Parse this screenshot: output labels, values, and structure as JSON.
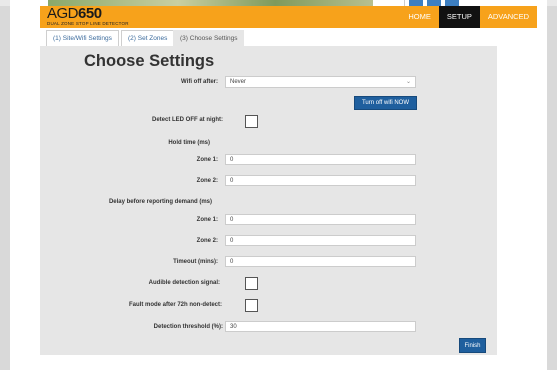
{
  "header": {
    "logo_light": "AGD",
    "logo_bold": "650",
    "logo_sub": "DUAL ZONE STOP LINE DETECTOR",
    "nav": [
      {
        "label": "HOME",
        "active": false
      },
      {
        "label": "SETUP",
        "active": true
      },
      {
        "label": "ADVANCED",
        "active": false
      }
    ]
  },
  "tabs": [
    {
      "label": "(1) Site/Wifi Settings"
    },
    {
      "label": "(2) Set Zones"
    },
    {
      "label": "(3) Choose Settings",
      "active": true
    }
  ],
  "form": {
    "title": "Choose Settings",
    "wifi_off_label": "Wifi off after:",
    "wifi_off_value": "Never",
    "turn_off_wifi_button": "Turn off wifi NOW",
    "detect_led_label": "Detect LED OFF at night:",
    "hold_time_label": "Hold time (ms)",
    "hold_zone1_label": "Zone 1:",
    "hold_zone1_value": "0",
    "hold_zone2_label": "Zone 2:",
    "hold_zone2_value": "0",
    "delay_label": "Delay before reporting demand (ms)",
    "delay_zone1_label": "Zone 1:",
    "delay_zone1_value": "0",
    "delay_zone2_label": "Zone 2:",
    "delay_zone2_value": "0",
    "timeout_label": "Timeout (mins):",
    "timeout_value": "0",
    "audible_label": "Audible detection signal:",
    "fault_mode_label": "Fault mode after 72h non-detect:",
    "threshold_label": "Detection threshold (%):",
    "threshold_value": "30",
    "finish_button": "Finish"
  },
  "colors": {
    "header_bg": "#f7a21b",
    "active_nav_bg": "#111111",
    "button_bg": "#1f5f9e",
    "panel_bg": "#e6e6e6"
  }
}
